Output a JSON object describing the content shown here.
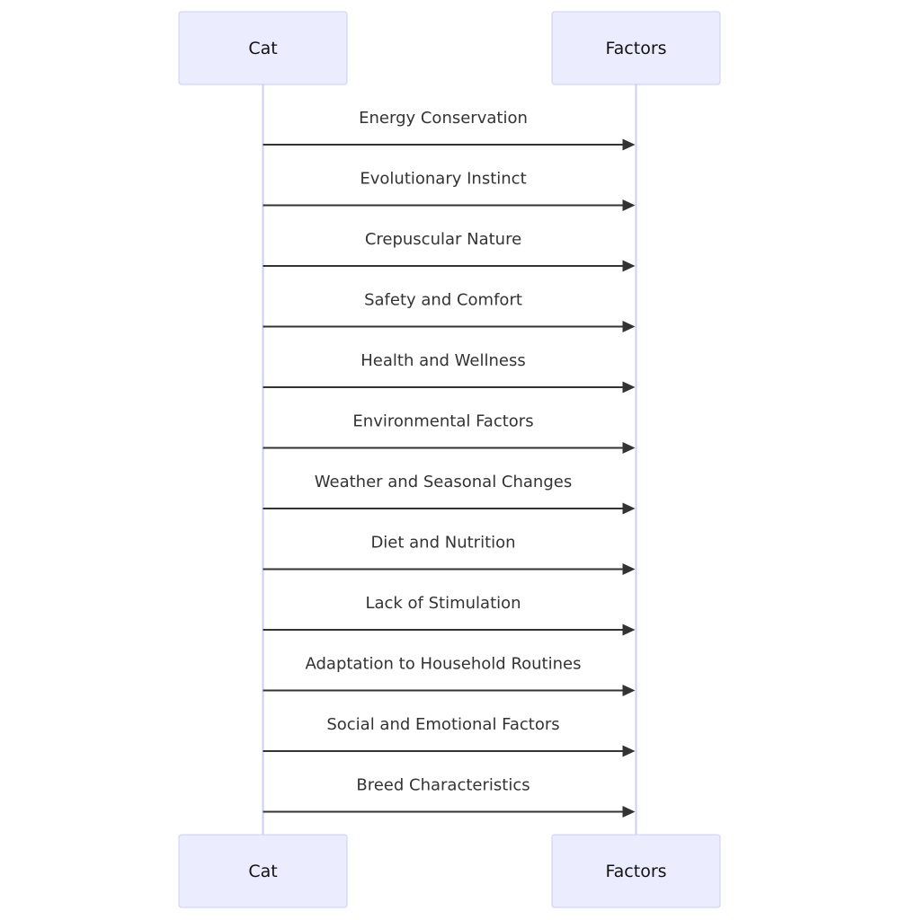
{
  "diagram": {
    "type": "sequence",
    "actors": [
      {
        "id": "cat",
        "label": "Cat"
      },
      {
        "id": "factors",
        "label": "Factors"
      }
    ],
    "messages": [
      {
        "from": "cat",
        "to": "factors",
        "label": "Energy Conservation"
      },
      {
        "from": "cat",
        "to": "factors",
        "label": "Evolutionary Instinct"
      },
      {
        "from": "cat",
        "to": "factors",
        "label": "Crepuscular Nature"
      },
      {
        "from": "cat",
        "to": "factors",
        "label": "Safety and Comfort"
      },
      {
        "from": "cat",
        "to": "factors",
        "label": "Health and Wellness"
      },
      {
        "from": "cat",
        "to": "factors",
        "label": "Environmental Factors"
      },
      {
        "from": "cat",
        "to": "factors",
        "label": "Weather and Seasonal Changes"
      },
      {
        "from": "cat",
        "to": "factors",
        "label": "Diet and Nutrition"
      },
      {
        "from": "cat",
        "to": "factors",
        "label": "Lack of Stimulation"
      },
      {
        "from": "cat",
        "to": "factors",
        "label": "Adaptation to Household Routines"
      },
      {
        "from": "cat",
        "to": "factors",
        "label": "Social and Emotional Factors"
      },
      {
        "from": "cat",
        "to": "factors",
        "label": "Breed Characteristics"
      }
    ],
    "colors": {
      "actor_fill": "#ECECFF",
      "actor_border": "#CCCCFF",
      "lifeline": "#CCCCFF",
      "message": "#333333",
      "text": "#333333"
    }
  }
}
